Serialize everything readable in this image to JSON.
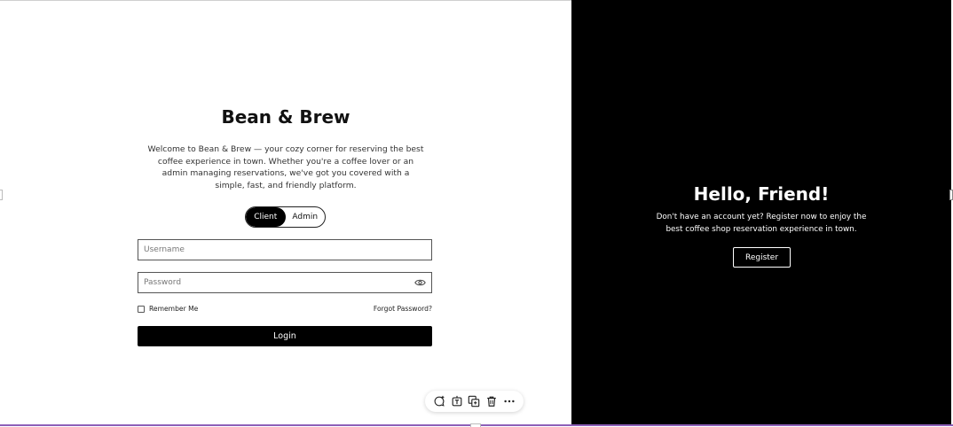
{
  "login": {
    "brand_title": "Bean & Brew",
    "welcome_text": "Welcome to Bean & Brew — your cozy corner for reserving the best coffee experience in town. Whether you're a coffee lover or an admin managing reservations, we've got you covered with a simple, fast, and friendly platform.",
    "roles": [
      {
        "label": "Client",
        "active": true
      },
      {
        "label": "Admin",
        "active": false
      }
    ],
    "username": {
      "value": "",
      "placeholder": "Username"
    },
    "password": {
      "value": "",
      "placeholder": "Password",
      "toggle_icon": "eye-icon"
    },
    "remember_label": "Remember Me",
    "remember_checked": false,
    "forgot_label": "Forgot Password?",
    "login_label": "Login"
  },
  "register_panel": {
    "heading": "Hello, Friend!",
    "message": "Don't have an account yet? Register now to enjoy the best coffee shop reservation experience in town.",
    "button_label": "Register"
  },
  "toolbar": {
    "icons": [
      "comment-add-icon",
      "text-frame-icon",
      "duplicate-icon",
      "trash-icon",
      "more-icon"
    ]
  },
  "colors": {
    "primary": "#000000",
    "background": "#ffffff",
    "selection_outline": "#8d5fb8"
  }
}
